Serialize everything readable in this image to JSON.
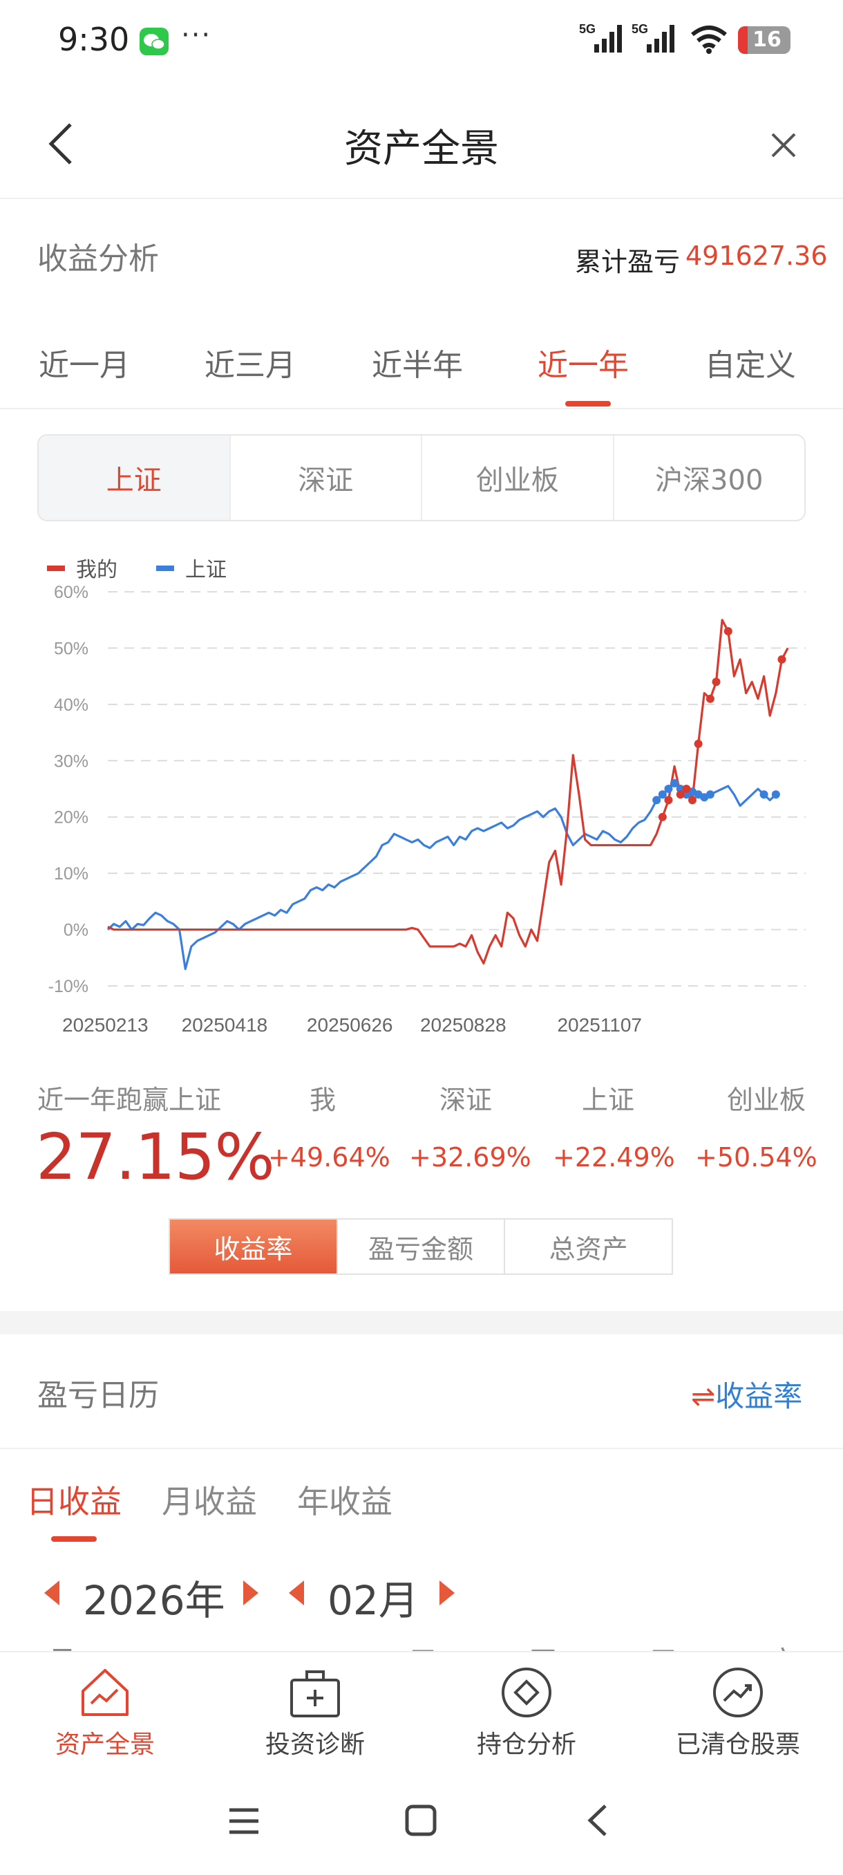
{
  "status_bar": {
    "time": "9:30",
    "more_dots": "···",
    "battery_level": "16",
    "network_labels": [
      "5G",
      "5G"
    ]
  },
  "header": {
    "title": "资产全景"
  },
  "profit_analysis": {
    "title": "收益分析",
    "cumulative_label": "累计盈亏",
    "cumulative_value": "491627.36"
  },
  "period_tabs": [
    "近一月",
    "近三月",
    "近半年",
    "近一年",
    "自定义"
  ],
  "period_active_index": 3,
  "index_tabs": [
    "上证",
    "深证",
    "创业板",
    "沪深300"
  ],
  "index_active_index": 0,
  "legend": {
    "mine": "我的",
    "benchmark": "上证"
  },
  "chart_data": {
    "type": "line",
    "title": "",
    "ylabel": "",
    "xlabel": "",
    "y_ticks": [
      "60%",
      "50%",
      "40%",
      "30%",
      "20%",
      "10%",
      "0%",
      "-10%"
    ],
    "ylim": [
      -10,
      60
    ],
    "x_tick_labels": [
      "20250213",
      "20250418",
      "20250626",
      "20250828",
      "20251107"
    ],
    "grid": true,
    "legend_position": "top-left",
    "series": [
      {
        "name": "我的",
        "color": "#d93a2f",
        "values": [
          0.5,
          0,
          0,
          0,
          0,
          0,
          0,
          0,
          0,
          0,
          0,
          0,
          0,
          0,
          0,
          0,
          0,
          0,
          0,
          0,
          0,
          0,
          0,
          0,
          0,
          0,
          0,
          0,
          0,
          0,
          0,
          0,
          0,
          0,
          0,
          0,
          0,
          0,
          0,
          0,
          0,
          0,
          0,
          0,
          0,
          0,
          0,
          0,
          0,
          0,
          0,
          0.3,
          0,
          -1.5,
          -3,
          -3,
          -3,
          -3,
          -3,
          -2.5,
          -3,
          -1,
          -4,
          -6,
          -3,
          -1,
          -3,
          3,
          2,
          -1,
          -3,
          0,
          -2,
          5,
          12,
          14,
          8,
          18,
          31,
          24,
          16,
          15,
          15,
          15,
          15,
          15,
          15,
          15,
          15,
          15,
          15,
          15,
          17,
          20,
          23,
          29,
          24,
          25,
          23,
          33,
          42,
          41,
          44,
          55,
          53,
          45,
          48,
          42,
          44,
          41,
          45,
          38,
          42,
          48,
          50
        ],
        "x_index_range": [
          0,
          117
        ]
      },
      {
        "name": "上证",
        "color": "#3a7fdc",
        "values": [
          0,
          1,
          0.5,
          1.5,
          0,
          1,
          0.8,
          2,
          3,
          2.5,
          1.5,
          1,
          0,
          -7,
          -3,
          -2,
          -1.5,
          -1,
          -0.5,
          0.5,
          1.5,
          1,
          0,
          1,
          1.5,
          2,
          2.5,
          3,
          2.5,
          3.5,
          3,
          4.5,
          5,
          5.5,
          7,
          7.5,
          7,
          8,
          7.5,
          8.5,
          9,
          9.5,
          10,
          11,
          12,
          13,
          15,
          15.5,
          17,
          16.5,
          16,
          15.5,
          16,
          15,
          14.5,
          15.5,
          16,
          16.5,
          15,
          16.5,
          16,
          17.5,
          18,
          17.5,
          18,
          18.5,
          19,
          18,
          18.5,
          19.5,
          20,
          20.5,
          21,
          20,
          21,
          21.5,
          20,
          17,
          15,
          16,
          17,
          16.5,
          16,
          17.5,
          17,
          16,
          15.5,
          16.5,
          18,
          19,
          19.5,
          21,
          23,
          24,
          25,
          26,
          25,
          24,
          24.5,
          24,
          23.5,
          24,
          24.5,
          25,
          25.5,
          24,
          22,
          23,
          24,
          25,
          24,
          23,
          24
        ],
        "x_index_range": [
          0,
          116
        ]
      }
    ],
    "markers": {
      "mine_indices": [
        93,
        94,
        96,
        97,
        98,
        99,
        101,
        102,
        104,
        113
      ],
      "benchmark_indices": [
        92,
        93,
        94,
        95,
        96,
        97,
        98,
        99,
        100,
        101,
        110,
        112
      ]
    }
  },
  "comparison": {
    "headline_label": "近一年跑赢上证",
    "headline_value": "27.15%",
    "columns": [
      {
        "label": "我",
        "value": "+49.64%"
      },
      {
        "label": "深证",
        "value": "+32.69%"
      },
      {
        "label": "上证",
        "value": "+22.49%"
      },
      {
        "label": "创业板",
        "value": "+50.54%"
      }
    ]
  },
  "metric_tabs": [
    "收益率",
    "盈亏金额",
    "总资产"
  ],
  "metric_active_index": 0,
  "calendar": {
    "title": "盈亏日历",
    "switch_icon": "⇌",
    "switch_label": "收益率",
    "tabs": [
      "日收益",
      "月收益",
      "年收益"
    ],
    "active_tab_index": 0,
    "year": "2026年",
    "month": "02月",
    "weekdays_partial": [
      "日",
      "一",
      "二",
      "三",
      "四",
      "五",
      "六"
    ]
  },
  "bottom_nav": [
    {
      "label": "资产全景",
      "icon": "house-chart-icon",
      "active": true
    },
    {
      "label": "投资诊断",
      "icon": "medical-kit-icon",
      "active": false
    },
    {
      "label": "持仓分析",
      "icon": "diamond-circle-icon",
      "active": false
    },
    {
      "label": "已清仓股票",
      "icon": "trend-circle-icon",
      "active": false
    }
  ],
  "colors": {
    "accent_red": "#e5452f",
    "mine_line": "#d93a2f",
    "benchmark_line": "#3a7fdc",
    "blue_link": "#2f7fd6"
  }
}
